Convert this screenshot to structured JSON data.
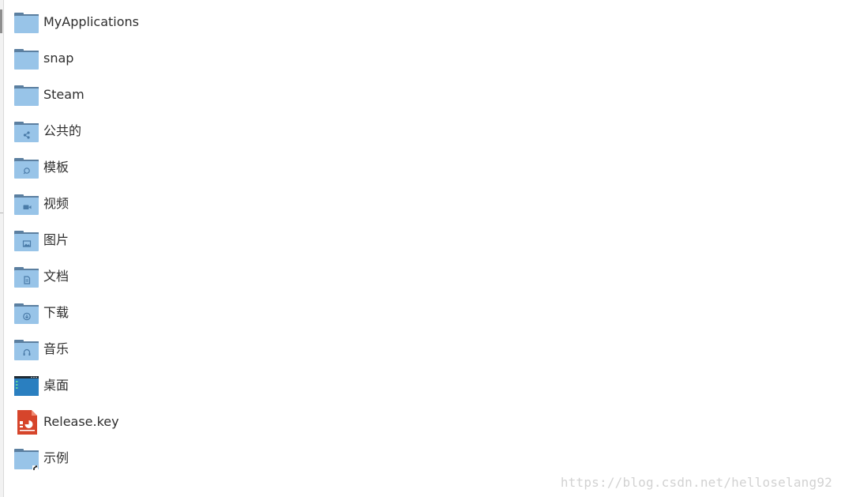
{
  "items": [
    {
      "label": "MyApplications",
      "icon": "folder-icon"
    },
    {
      "label": "snap",
      "icon": "folder-icon"
    },
    {
      "label": "Steam",
      "icon": "folder-icon"
    },
    {
      "label": "公共的",
      "icon": "folder-publicshare-icon"
    },
    {
      "label": "模板",
      "icon": "folder-templates-icon"
    },
    {
      "label": "视频",
      "icon": "folder-videos-icon"
    },
    {
      "label": "图片",
      "icon": "folder-pictures-icon"
    },
    {
      "label": "文档",
      "icon": "folder-documents-icon"
    },
    {
      "label": "下载",
      "icon": "folder-download-icon"
    },
    {
      "label": "音乐",
      "icon": "folder-music-icon"
    },
    {
      "label": "桌面",
      "icon": "desktop-folder-icon"
    },
    {
      "label": "Release.key",
      "icon": "presentation-file-icon"
    },
    {
      "label": "示例",
      "icon": "folder-symlink-icon"
    }
  ],
  "watermark": "https://blog.csdn.net/helloselang92",
  "colors": {
    "folder_body": "#98c4e8",
    "folder_tab": "#5b7fa0",
    "folder_glyph": "#4a7ba8",
    "desktop_body": "#2a7fc0",
    "desktop_top": "#1f2a33",
    "file_red": "#d6452b"
  }
}
